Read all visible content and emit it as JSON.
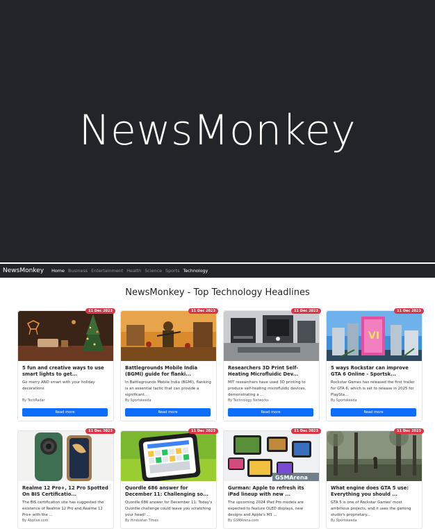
{
  "hero": {
    "title": "NewsMonkey"
  },
  "navbar": {
    "brand": "NewsMonkey",
    "links": [
      "Home",
      "Business",
      "Entertainment",
      "Health",
      "Science",
      "Sports",
      "Technology"
    ]
  },
  "page": {
    "heading": "NewsMonkey - Top Technology Headlines"
  },
  "read_more_label": "Read more",
  "cards": [
    {
      "date": "11 Dec 2023",
      "title": "5 fun and creative ways to use smart lights to get...",
      "description": "Go merry AND smart with your holiday decorations",
      "source": "By TechRadar"
    },
    {
      "date": "11 Dec 2023",
      "title": "Battlegrounds Mobile India (BGMI) guide for flanki...",
      "description": "In Battlegrounds Mobile India (BGMI), flanking is an essential tactic that can provide a significant...",
      "source": "By Sportskeeda"
    },
    {
      "date": "11 Dec 2023",
      "title": "Researchers 3D Print Self-Heating Microfluidic Dev...",
      "description": "MIT researchers have used 3D printing to produce self-heating microfluidic devices, demonstrating a ...",
      "source": "By Technology Networks"
    },
    {
      "date": "11 Dec 2023",
      "title": "5 ways Rockstar can improve GTA 6 Online - Sportsk...",
      "description": "Rockstar Games has released the first trailer for GTA 6, which is set to release in 2025 for PlaySta...",
      "source": "By Sportskeeda"
    },
    {
      "date": "11 Dec 2023",
      "title": "Realme 12 Pro+, 12 Pro Spotted On BIS Certificatio...",
      "description": "The BIS certification site has suggested the existence of Realme 12 Pro and Realme 12 Pro+ with the ...",
      "source": "By Abplive.com"
    },
    {
      "date": "11 Dec 2023",
      "title": "Quordle 686 answer for December 11: Challenging so...",
      "description": "Quordle 686 answer for December 11: Today's Quordle challenge could leave you scratching your head! ...",
      "source": "By Hindustan Times"
    },
    {
      "date": "11 Dec 2023",
      "title": "Gurman: Apple to refresh its iPad lineup with new ...",
      "description": "The upcoming 2024 iPad Pro models are expected to feature OLED displays, new designs and Apple's M3 ...",
      "source": "By GSMArena.com",
      "image_watermark": "GSMArena"
    },
    {
      "date": "11 Dec 2023",
      "title": "What engine does GTA 5 use: Everything you should ...",
      "description": "GTA 5 is one of Rockstar Games' most ambitious projects, and it uses the gaming studio's proprietary...",
      "source": "By Sportskeeda"
    }
  ],
  "colors": {
    "dark": "#212529",
    "primary": "#0d6efd",
    "badge": "#dc3545"
  }
}
